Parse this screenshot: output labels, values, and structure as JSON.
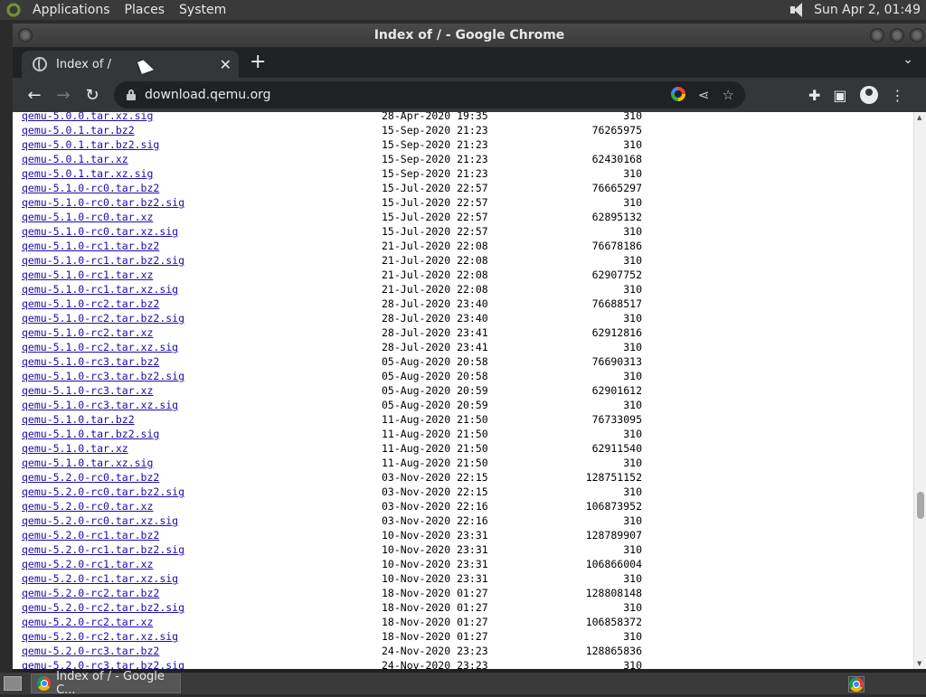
{
  "top_panel": {
    "menus": [
      "Applications",
      "Places",
      "System"
    ],
    "clock": "Sun Apr  2, 01:49"
  },
  "window": {
    "title": "Index of / - Google Chrome"
  },
  "tab": {
    "title": "Index of /",
    "new_tab_label": "+"
  },
  "toolbar": {
    "url": "download.qemu.org"
  },
  "listing": [
    {
      "name": "qemu-5.0.0.tar.xz.sig",
      "date": "28-Apr-2020 19:35",
      "size": "310"
    },
    {
      "name": "qemu-5.0.1.tar.bz2",
      "date": "15-Sep-2020 21:23",
      "size": "76265975"
    },
    {
      "name": "qemu-5.0.1.tar.bz2.sig",
      "date": "15-Sep-2020 21:23",
      "size": "310"
    },
    {
      "name": "qemu-5.0.1.tar.xz",
      "date": "15-Sep-2020 21:23",
      "size": "62430168"
    },
    {
      "name": "qemu-5.0.1.tar.xz.sig",
      "date": "15-Sep-2020 21:23",
      "size": "310"
    },
    {
      "name": "qemu-5.1.0-rc0.tar.bz2",
      "date": "15-Jul-2020 22:57",
      "size": "76665297"
    },
    {
      "name": "qemu-5.1.0-rc0.tar.bz2.sig",
      "date": "15-Jul-2020 22:57",
      "size": "310"
    },
    {
      "name": "qemu-5.1.0-rc0.tar.xz",
      "date": "15-Jul-2020 22:57",
      "size": "62895132"
    },
    {
      "name": "qemu-5.1.0-rc0.tar.xz.sig",
      "date": "15-Jul-2020 22:57",
      "size": "310"
    },
    {
      "name": "qemu-5.1.0-rc1.tar.bz2",
      "date": "21-Jul-2020 22:08",
      "size": "76678186"
    },
    {
      "name": "qemu-5.1.0-rc1.tar.bz2.sig",
      "date": "21-Jul-2020 22:08",
      "size": "310"
    },
    {
      "name": "qemu-5.1.0-rc1.tar.xz",
      "date": "21-Jul-2020 22:08",
      "size": "62907752"
    },
    {
      "name": "qemu-5.1.0-rc1.tar.xz.sig",
      "date": "21-Jul-2020 22:08",
      "size": "310"
    },
    {
      "name": "qemu-5.1.0-rc2.tar.bz2",
      "date": "28-Jul-2020 23:40",
      "size": "76688517"
    },
    {
      "name": "qemu-5.1.0-rc2.tar.bz2.sig",
      "date": "28-Jul-2020 23:40",
      "size": "310"
    },
    {
      "name": "qemu-5.1.0-rc2.tar.xz",
      "date": "28-Jul-2020 23:41",
      "size": "62912816"
    },
    {
      "name": "qemu-5.1.0-rc2.tar.xz.sig",
      "date": "28-Jul-2020 23:41",
      "size": "310"
    },
    {
      "name": "qemu-5.1.0-rc3.tar.bz2",
      "date": "05-Aug-2020 20:58",
      "size": "76690313"
    },
    {
      "name": "qemu-5.1.0-rc3.tar.bz2.sig",
      "date": "05-Aug-2020 20:58",
      "size": "310"
    },
    {
      "name": "qemu-5.1.0-rc3.tar.xz",
      "date": "05-Aug-2020 20:59",
      "size": "62901612"
    },
    {
      "name": "qemu-5.1.0-rc3.tar.xz.sig",
      "date": "05-Aug-2020 20:59",
      "size": "310"
    },
    {
      "name": "qemu-5.1.0.tar.bz2",
      "date": "11-Aug-2020 21:50",
      "size": "76733095"
    },
    {
      "name": "qemu-5.1.0.tar.bz2.sig",
      "date": "11-Aug-2020 21:50",
      "size": "310"
    },
    {
      "name": "qemu-5.1.0.tar.xz",
      "date": "11-Aug-2020 21:50",
      "size": "62911540"
    },
    {
      "name": "qemu-5.1.0.tar.xz.sig",
      "date": "11-Aug-2020 21:50",
      "size": "310"
    },
    {
      "name": "qemu-5.2.0-rc0.tar.bz2",
      "date": "03-Nov-2020 22:15",
      "size": "128751152"
    },
    {
      "name": "qemu-5.2.0-rc0.tar.bz2.sig",
      "date": "03-Nov-2020 22:15",
      "size": "310"
    },
    {
      "name": "qemu-5.2.0-rc0.tar.xz",
      "date": "03-Nov-2020 22:16",
      "size": "106873952"
    },
    {
      "name": "qemu-5.2.0-rc0.tar.xz.sig",
      "date": "03-Nov-2020 22:16",
      "size": "310"
    },
    {
      "name": "qemu-5.2.0-rc1.tar.bz2",
      "date": "10-Nov-2020 23:31",
      "size": "128789907"
    },
    {
      "name": "qemu-5.2.0-rc1.tar.bz2.sig",
      "date": "10-Nov-2020 23:31",
      "size": "310"
    },
    {
      "name": "qemu-5.2.0-rc1.tar.xz",
      "date": "10-Nov-2020 23:31",
      "size": "106866004"
    },
    {
      "name": "qemu-5.2.0-rc1.tar.xz.sig",
      "date": "10-Nov-2020 23:31",
      "size": "310"
    },
    {
      "name": "qemu-5.2.0-rc2.tar.bz2",
      "date": "18-Nov-2020 01:27",
      "size": "128808148"
    },
    {
      "name": "qemu-5.2.0-rc2.tar.bz2.sig",
      "date": "18-Nov-2020 01:27",
      "size": "310"
    },
    {
      "name": "qemu-5.2.0-rc2.tar.xz",
      "date": "18-Nov-2020 01:27",
      "size": "106858372"
    },
    {
      "name": "qemu-5.2.0-rc2.tar.xz.sig",
      "date": "18-Nov-2020 01:27",
      "size": "310"
    },
    {
      "name": "qemu-5.2.0-rc3.tar.bz2",
      "date": "24-Nov-2020 23:23",
      "size": "128865836"
    },
    {
      "name": "qemu-5.2.0-rc3.tar.bz2.sig",
      "date": "24-Nov-2020 23:23",
      "size": "310"
    }
  ],
  "taskbar": {
    "task_label": "Index of / - Google C..."
  },
  "colors": {
    "link": "#1a0dab",
    "chrome_dark": "#35363a"
  }
}
